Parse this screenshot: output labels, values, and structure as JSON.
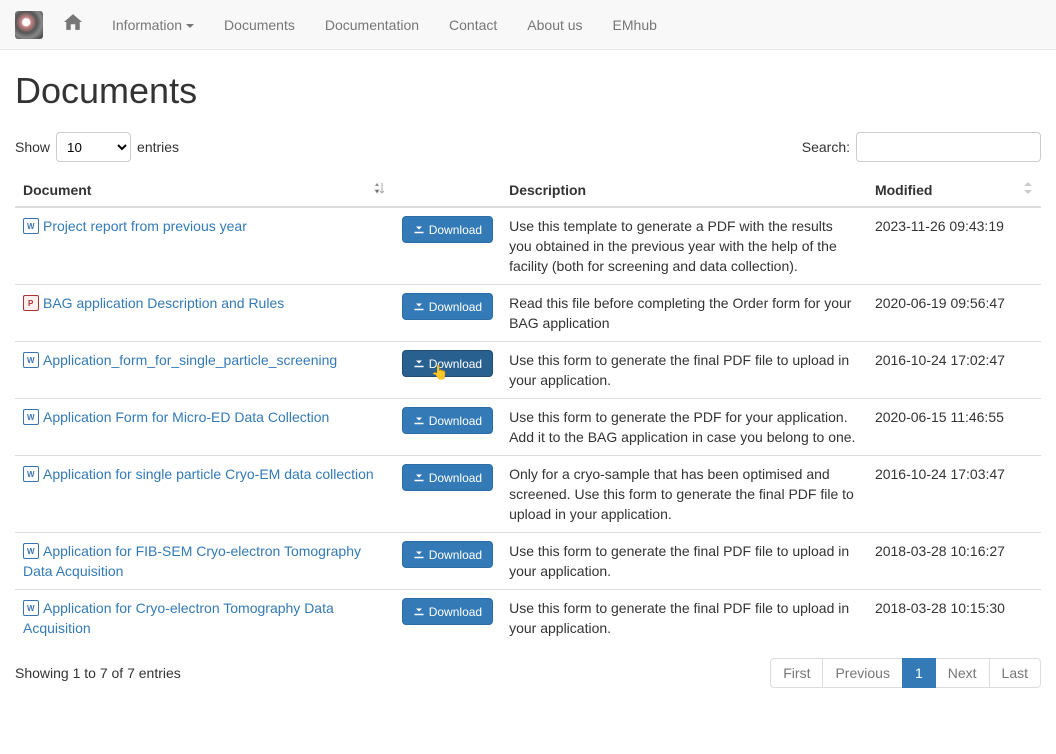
{
  "nav": {
    "items": [
      "Information",
      "Documents",
      "Documentation",
      "Contact",
      "About us",
      "EMhub"
    ]
  },
  "page_title": "Documents",
  "table_controls": {
    "show_prefix": "Show",
    "show_suffix": "entries",
    "page_size": "10",
    "search_label": "Search:"
  },
  "columns": {
    "document": "Document",
    "download": "",
    "description": "Description",
    "modified": "Modified"
  },
  "download_label": "Download",
  "rows": [
    {
      "icon": "doc",
      "title": "Project report from previous year",
      "description": "Use this template to generate a PDF with the results you obtained in the previous year with the help of the facility (both for screening and data collection).",
      "modified": "2023-11-26 09:43:19"
    },
    {
      "icon": "pdf",
      "title": "BAG application Description and Rules",
      "description": "Read this file before completing the Order form for your BAG application",
      "modified": "2020-06-19 09:56:47"
    },
    {
      "icon": "doc",
      "title": "Application_form_for_single_particle_screening",
      "description": "Use this form to generate the final PDF file to upload in your application.",
      "modified": "2016-10-24 17:02:47",
      "hover": true
    },
    {
      "icon": "doc",
      "title": "Application Form for Micro-ED Data Collection",
      "description": "Use this form to generate the PDF for your application. Add it to the BAG application in case you belong to one.",
      "modified": "2020-06-15 11:46:55"
    },
    {
      "icon": "doc",
      "title": "Application for single particle Cryo-EM data collection",
      "description": "Only for a cryo-sample that has been optimised and screened. Use this form to generate the final PDF file to upload in your application.",
      "modified": "2016-10-24 17:03:47"
    },
    {
      "icon": "doc",
      "title": "Application for FIB-SEM Cryo-electron Tomography Data Acquisition",
      "description": "Use this form to generate the final PDF file to upload in your application.",
      "modified": "2018-03-28 10:16:27"
    },
    {
      "icon": "doc",
      "title": "Application for Cryo-electron Tomography Data Acquisition",
      "description": "Use this form to generate the final PDF file to upload in your application.",
      "modified": "2018-03-28 10:15:30"
    }
  ],
  "footer": {
    "info": "Showing 1 to 7 of 7 entries",
    "pagination": {
      "first": "First",
      "previous": "Previous",
      "page": "1",
      "next": "Next",
      "last": "Last"
    }
  }
}
